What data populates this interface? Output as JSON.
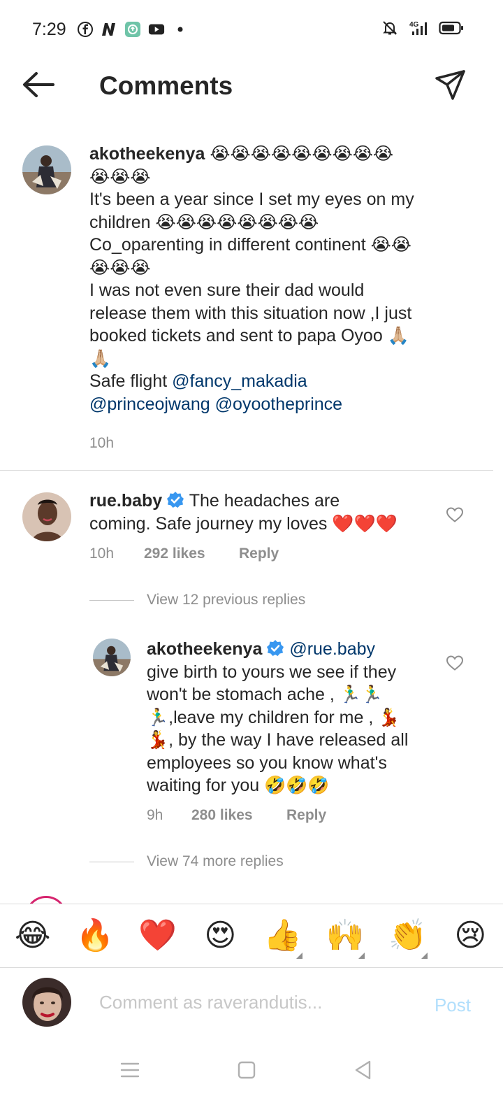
{
  "status_bar": {
    "time": "7:29",
    "left_icons": [
      "facebook-icon",
      "n-app-icon",
      "teal-app-icon",
      "youtube-icon",
      "dot-icon"
    ],
    "right_icons": [
      "silent-bell-icon",
      "signal-4g-icon",
      "battery-icon"
    ],
    "network": "4G"
  },
  "header": {
    "title": "Comments"
  },
  "caption": {
    "username": "akotheekenya",
    "text_lines": [
      "😭😭😭😭😭😭😭😭😭",
      "😭😭😭",
      "It's been a year since I set my eyes on my",
      "children 😭😭😭😭😭😭😭😭",
      "Co_oparenting in different continent 😭😭",
      "😭😭😭",
      "I was not even sure their dad would",
      "release them with this situation now ,I just",
      "booked tickets and sent to papa Oyoo 🙏🏼",
      "🙏🏼"
    ],
    "safe_flight": "Safe flight",
    "mentions": [
      "@fancy_makadia",
      "@princeojwang",
      "@oyootheprince"
    ],
    "time": "10h"
  },
  "comments": [
    {
      "username": "rue.baby",
      "verified": true,
      "text_line1": "The headaches are",
      "text_line2": "coming. Safe journey my loves ❤️❤️❤️",
      "time": "10h",
      "likes": "292 likes",
      "reply_label": "Reply",
      "view_previous": "View 12 previous replies",
      "reply": {
        "username": "akotheekenya",
        "verified": true,
        "mention": "@rue.baby",
        "text_lines": [
          "give birth to yours we see if they",
          "won't be stomach ache , 🏃‍♂️🏃‍♂️",
          "🏃‍♂️,leave my children for me , 💃",
          "💃, by the way I have released all",
          "employees so you know what's",
          "waiting for you 🤣🤣🤣"
        ],
        "time": "9h",
        "likes": "280 likes",
        "reply_label": "Reply"
      },
      "view_more": "View 74 more replies"
    }
  ],
  "emoji_bar": [
    "😂",
    "🔥",
    "❤️",
    "😍",
    "👍",
    "🙌",
    "👏",
    "😢"
  ],
  "compose": {
    "placeholder": "Comment as raverandutis...",
    "post_label": "Post"
  },
  "colors": {
    "mention": "#00376b",
    "secondary_text": "#8e8e8e",
    "post_disabled": "#b2dffc",
    "verified": "#3897f0",
    "heart_red": "#ed4956"
  }
}
